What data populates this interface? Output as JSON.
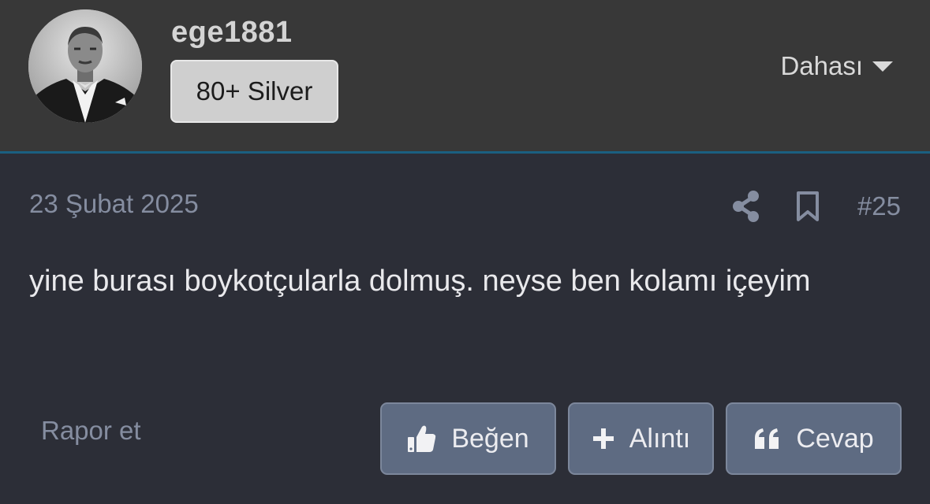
{
  "header": {
    "username": "ege1881",
    "badge": "80+ Silver",
    "more_label": "Dahası"
  },
  "post": {
    "date": "23 Şubat 2025",
    "number": "#25",
    "body": "yine burası boykotçularla dolmuş. neyse ben kolamı içeyim"
  },
  "footer": {
    "report_label": "Rapor et",
    "like_label": "Beğen",
    "quote_label": "Alıntı",
    "reply_label": "Cevap"
  },
  "colors": {
    "header_bg": "#383838",
    "page_bg": "#2c2e37",
    "accent_border": "#1b5f80",
    "button_bg": "#5e6b82",
    "muted_text": "#858da0"
  },
  "icons": [
    "share-icon",
    "bookmark-icon",
    "thumbs-up-icon",
    "plus-icon",
    "quote-icon",
    "caret-down-icon"
  ]
}
